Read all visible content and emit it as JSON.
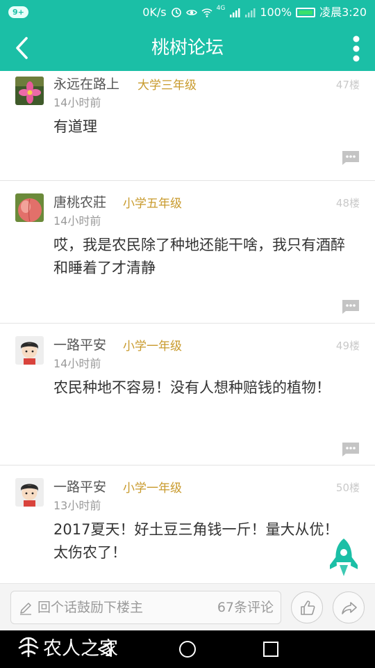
{
  "status_bar": {
    "notification_badge": "9+",
    "speed": "0K/s",
    "network": "4G",
    "battery": "100%",
    "time": "凌晨3:20"
  },
  "app_bar": {
    "title": "桃树论坛"
  },
  "posts": [
    {
      "username": "永远在路上",
      "grade": "大学三年级",
      "time": "14小时前",
      "floor": "47楼",
      "content": "有道理",
      "avatar": "pink-flower-avatar"
    },
    {
      "username": "唐桃农莊",
      "grade": "小学五年级",
      "time": "14小时前",
      "floor": "48楼",
      "content": "哎，我是农民除了种地还能干啥，我只有酒醉和睡着了才清静",
      "avatar": "peach-avatar"
    },
    {
      "username": "一路平安",
      "grade": "小学一年级",
      "time": "14小时前",
      "floor": "49楼",
      "content": "农民种地不容易！没有人想种赔钱的植物！",
      "avatar": "cartoon-boy-avatar"
    },
    {
      "username": "一路平安",
      "grade": "小学一年级",
      "time": "13小时前",
      "floor": "50楼",
      "content": "2017夏天！好土豆三角钱一斤！量大从优！太伤农了！",
      "avatar": "cartoon-boy-avatar"
    }
  ],
  "bottom_bar": {
    "comment_placeholder": "回个话鼓励下楼主",
    "comment_count": "67条评论"
  },
  "watermark": {
    "text": "农人之家"
  },
  "colors": {
    "accent": "#1bbfa6",
    "grade": "#c89a2c"
  }
}
